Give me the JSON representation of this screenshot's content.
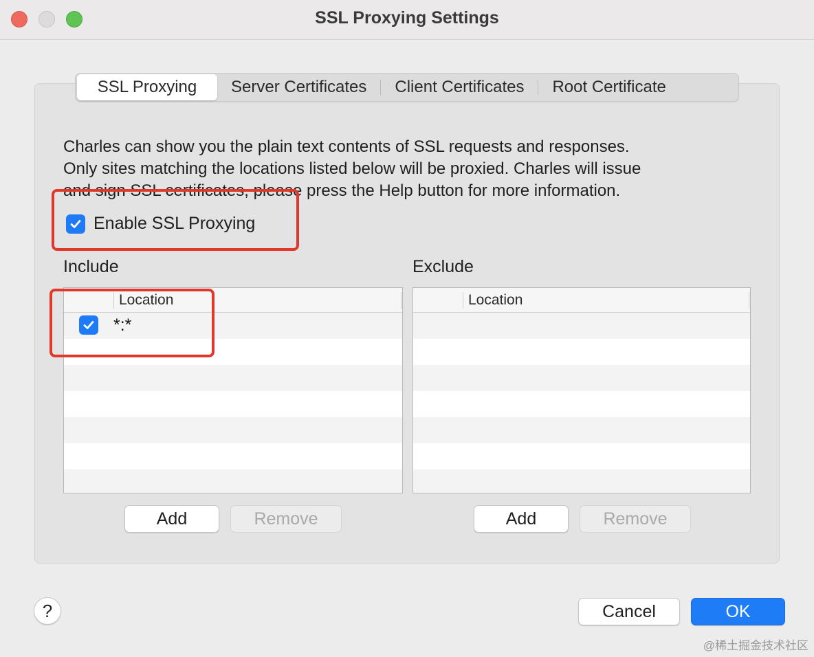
{
  "window": {
    "title": "SSL Proxying Settings"
  },
  "tabs": [
    {
      "label": "SSL Proxying",
      "active": true
    },
    {
      "label": "Server Certificates",
      "active": false
    },
    {
      "label": "Client Certificates",
      "active": false
    },
    {
      "label": "Root Certificate",
      "active": false
    }
  ],
  "description": {
    "line1": "Charles can show you the plain text contents of SSL requests and responses.",
    "line2": "Only sites matching the locations listed below will be proxied. Charles will issue",
    "line3": "and sign SSL certificates, please press the Help button for more information."
  },
  "enable_ssl": {
    "label": "Enable SSL Proxying",
    "checked": true
  },
  "include": {
    "label": "Include",
    "column_header": "Location",
    "rows": [
      {
        "checked": true,
        "location": "*:*"
      }
    ],
    "add_label": "Add",
    "remove_label": "Remove"
  },
  "exclude": {
    "label": "Exclude",
    "column_header": "Location",
    "rows": [],
    "add_label": "Add",
    "remove_label": "Remove"
  },
  "footer": {
    "help_label": "?",
    "cancel_label": "Cancel",
    "ok_label": "OK"
  },
  "watermark": "@稀土掘金技术社区",
  "colors": {
    "accent": "#1e7cf6",
    "highlight": "#e0392b"
  }
}
